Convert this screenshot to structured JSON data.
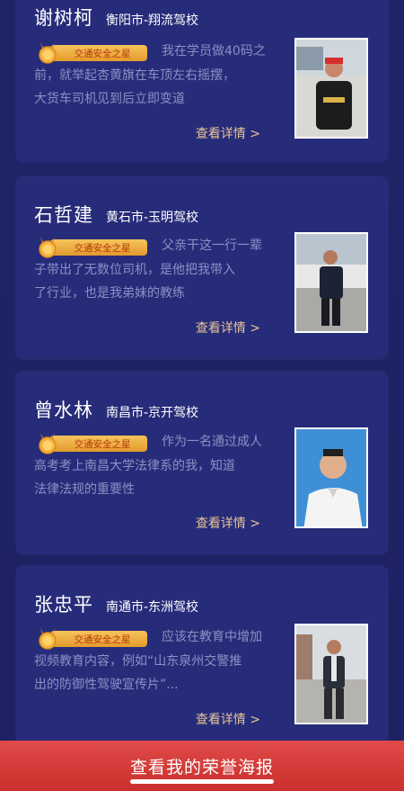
{
  "colors": {
    "background": "#1e2266",
    "card": "#272c7a",
    "badge": "#f0b24a",
    "details_link": "#e9c496",
    "cta": "#d63c3a"
  },
  "badge_label": "交通安全之星",
  "details_label": "查看详情 >",
  "cards": [
    {
      "name": "谢树柯",
      "school": "衡阳市-翔流驾校",
      "story": [
        "我在学员做40码之",
        "前，就举起杏黄旗在车顶左右摇摆，",
        "大货车司机见到后立即变道"
      ]
    },
    {
      "name": "石哲建",
      "school": "黄石市-玉明驾校",
      "story": [
        "父亲干这一行一辈",
        "子带出了无数位司机，是他把我带入",
        "了行业，也是我弟妹的教练"
      ]
    },
    {
      "name": "曾水林",
      "school": "南昌市-京开驾校",
      "story": [
        "作为一名通过成人",
        "高考考上南昌大学法律系的我，知道",
        "法律法规的重要性"
      ]
    },
    {
      "name": "张忠平",
      "school": "南通市-东洲驾校",
      "story": [
        "应该在教育中增加",
        "视频教育内容，例如“山东泉州交警推",
        "出的防御性驾驶宣传片”..."
      ]
    }
  ],
  "cta_label": "查看我的荣誉海报"
}
